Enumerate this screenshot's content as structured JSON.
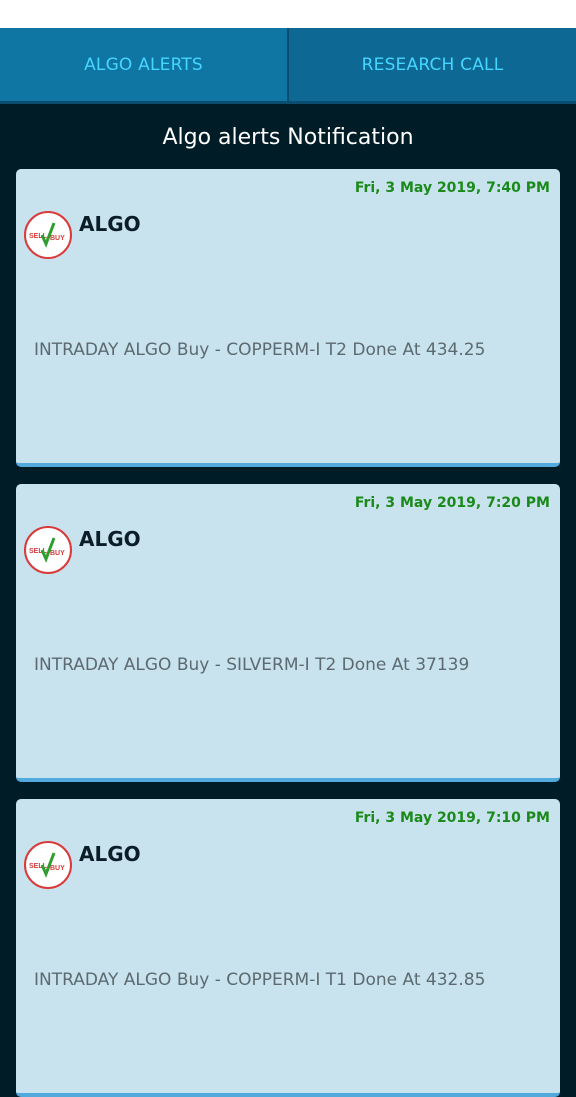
{
  "tabs": [
    {
      "label": "ALGO ALERTS"
    },
    {
      "label": "RESEARCH CALL"
    }
  ],
  "page": {
    "title": "Algo alerts Notification"
  },
  "logo": {
    "sell": "SELL",
    "buy": "BUY"
  },
  "alerts": [
    {
      "date": "Fri, 3 May 2019, 7:40 PM",
      "title": "ALGO",
      "message": "INTRADAY ALGO Buy - COPPERM-I T2 Done At 434.25"
    },
    {
      "date": "Fri, 3 May 2019, 7:20 PM",
      "title": "ALGO",
      "message": "INTRADAY ALGO Buy - SILVERM-I T2 Done At 37139"
    },
    {
      "date": "Fri, 3 May 2019, 7:10 PM",
      "title": "ALGO",
      "message": "INTRADAY ALGO Buy - COPPERM-I T1 Done At 432.85"
    }
  ],
  "colors": {
    "tab_text": "#44d6ff",
    "date_text": "#1b8a1b",
    "card_bg": "#c9e3ee",
    "page_bg": "#001c26"
  }
}
